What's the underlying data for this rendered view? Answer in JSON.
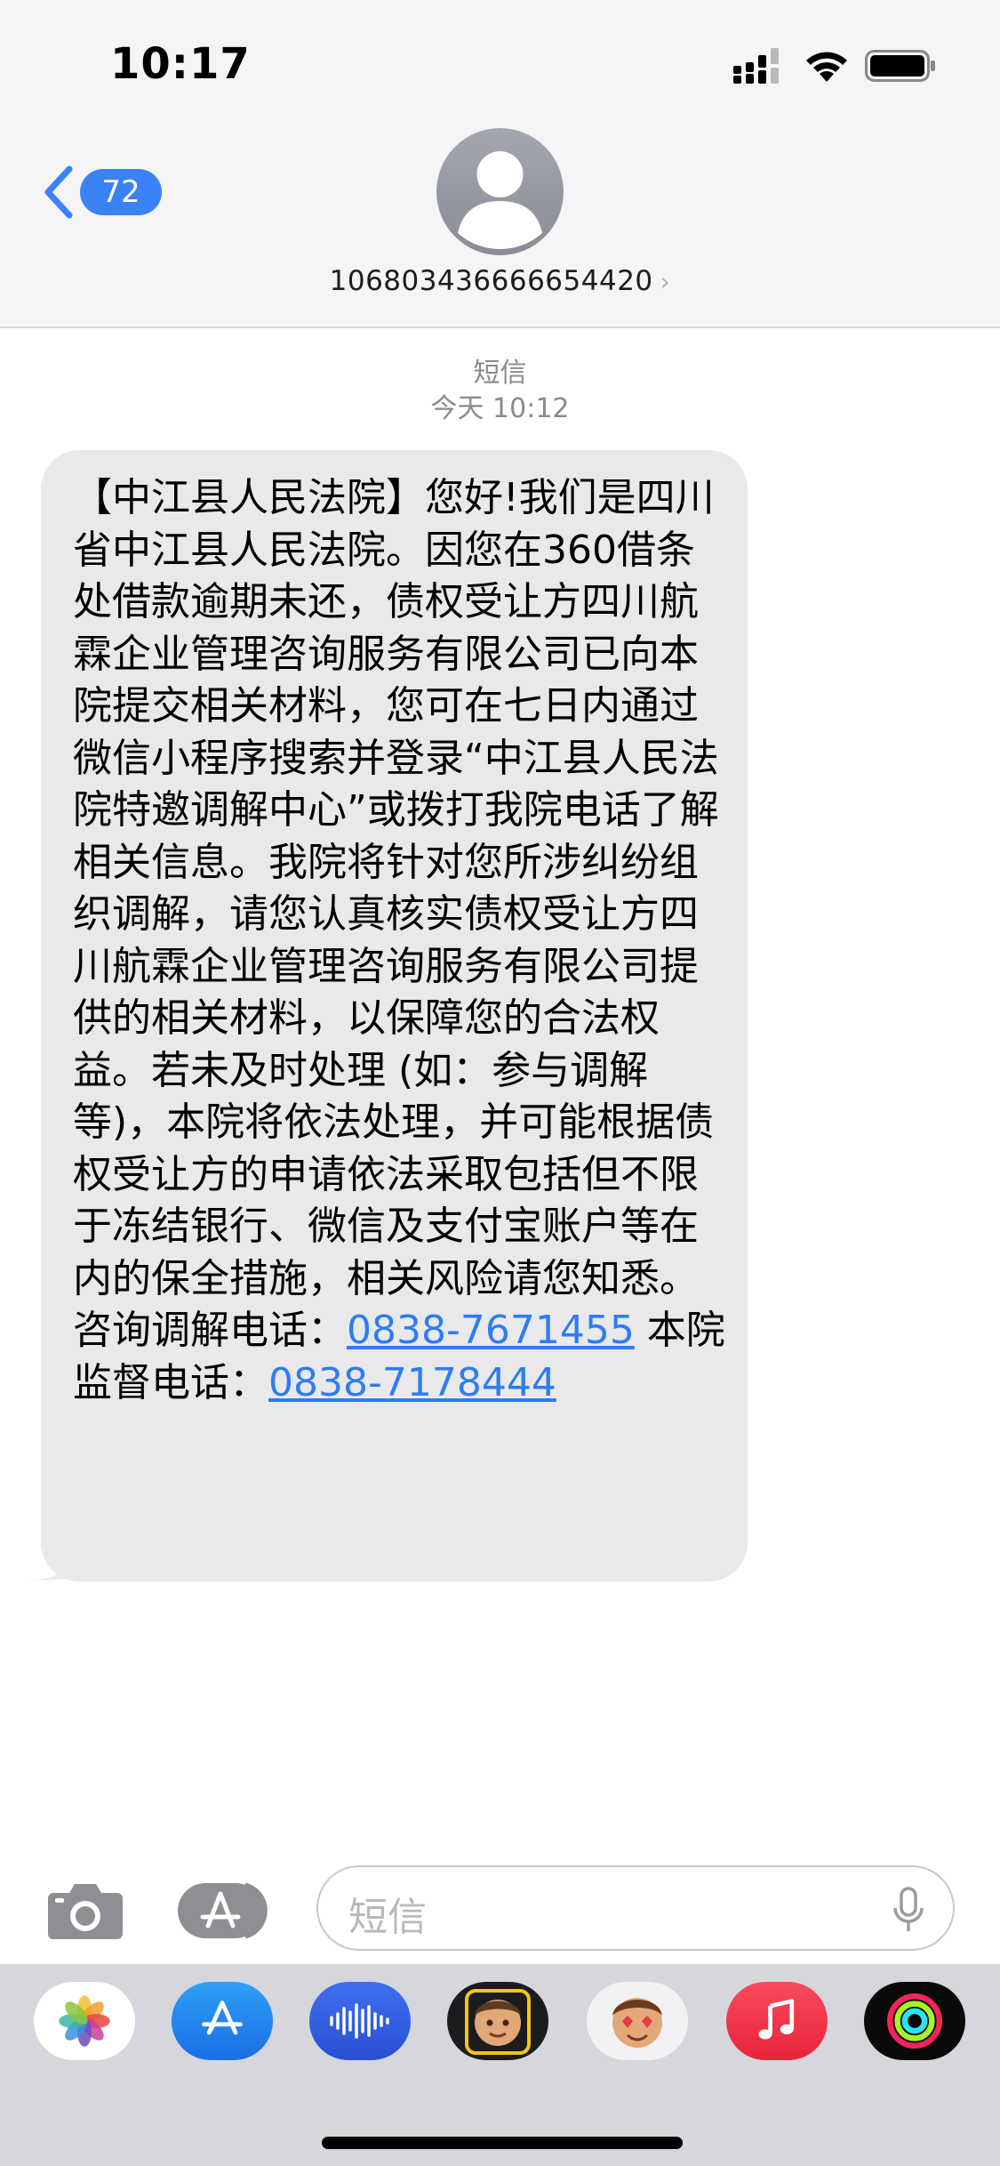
{
  "status_bar": {
    "time": "10:17"
  },
  "header": {
    "back_badge": "72",
    "contact": "106803436666654420",
    "contact_chevron": "›"
  },
  "conversation": {
    "service": "短信",
    "timestamp": "今天 10:12",
    "message_text": "【中江县人民法院】您好!我们是四川省中江县人民法院。因您在360借条处借款逾期未还，债权受让方四川航霖企业管理咨询服务有限公司已向本院提交相关材料，您可在七日内通过微信小程序搜索并登录“中江县人民法院特邀调解中心”或拨打我院电话了解相关信息。我院将针对您所涉纠纷组织调解，请您认真核实债权受让方四川航霖企业管理咨询服务有限公司提供的相关材料，以保障您的合法权益。若未及时处理 (如：参与调解等)，本院将依法处理，并可能根据债权受让方的申请依法采取包括但不限于冻结银行、微信及支付宝账户等在内的保全措施，相关风险请您知悉。 咨询调解电话：",
    "phone_consult": "0838-7671455",
    "supervise_label": " 本院监督电话：",
    "phone_supervise": "0838-7178444"
  },
  "input_bar": {
    "placeholder": "短信"
  },
  "app_drawer": {
    "apps": [
      "photos-icon",
      "app-store-icon",
      "audio-icon",
      "memoji-icon",
      "animoji-icon",
      "music-icon",
      "fitness-icon"
    ]
  },
  "colors": {
    "accent": "#3a82f6",
    "link": "#2e7cf6",
    "bubble": "#e9e9eb",
    "header_bg": "#f5f5f7"
  }
}
